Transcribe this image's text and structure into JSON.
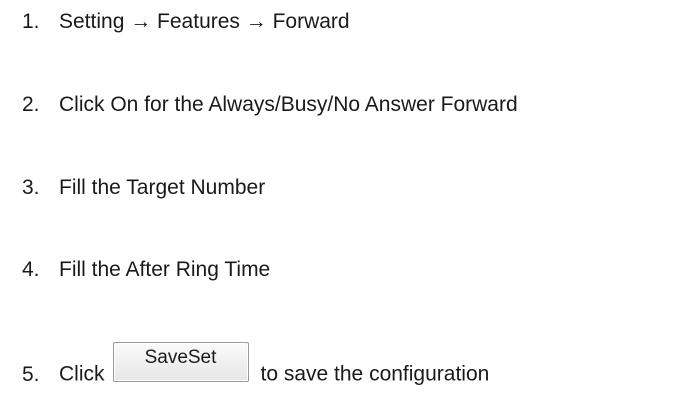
{
  "steps": [
    {
      "number": "1.",
      "text": "Setting → Features → Forward"
    },
    {
      "number": "2.",
      "text": "Click On for the Always/Busy/No Answer Forward"
    },
    {
      "number": "3.",
      "text": "Fill the Target Number"
    },
    {
      "number": "4.",
      "text": "Fill the After Ring Time"
    },
    {
      "number": "5.",
      "text_before": "Click",
      "button_label": "SaveSet",
      "text_after": "to save the configuration"
    }
  ]
}
